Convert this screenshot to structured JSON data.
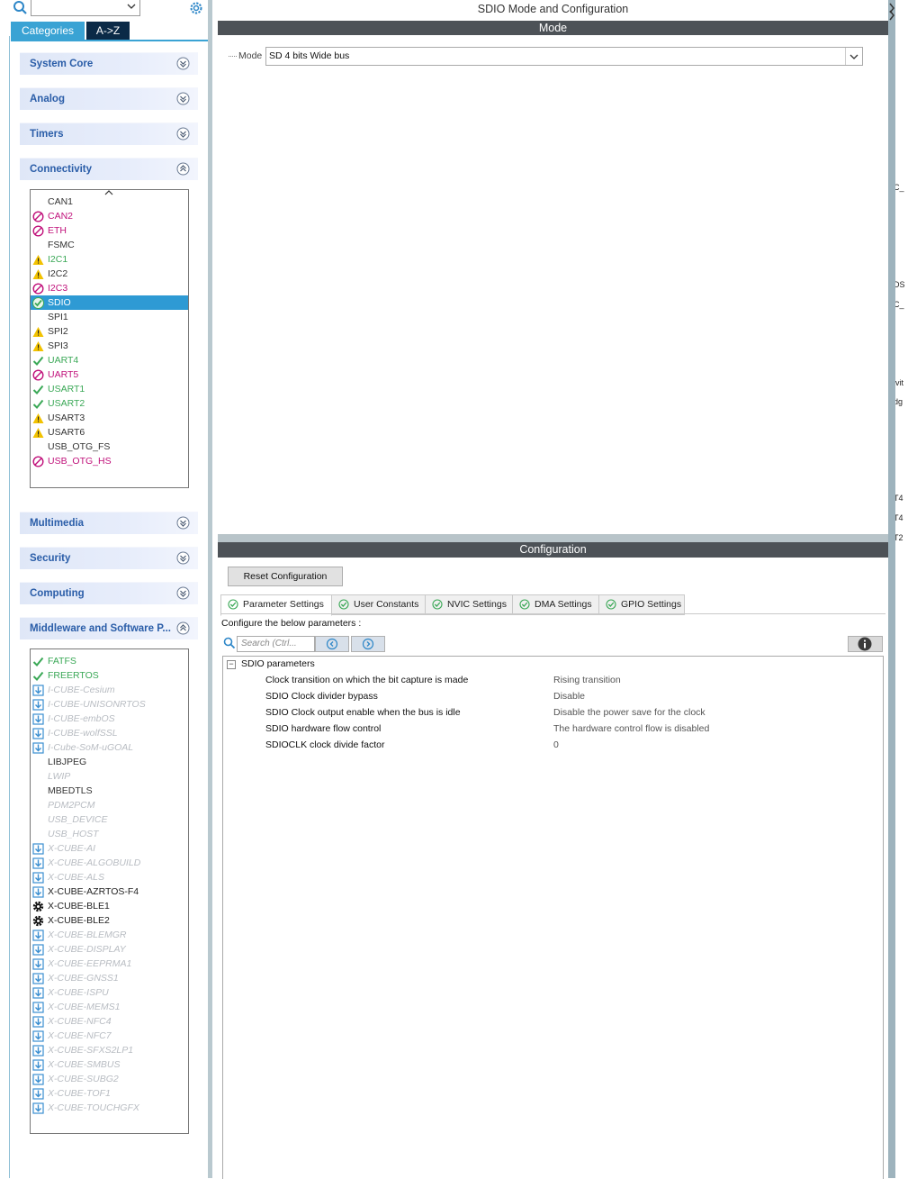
{
  "colors": {
    "accent": "#3aa3d4",
    "dark_tab": "#0b2a47",
    "category_text": "#2a5da8",
    "error": "#c0107a",
    "ok": "#3aa856",
    "warn": "#f2c200",
    "disabled": "#b8bcc2",
    "section_bar": "#4d5257",
    "selection": "#2e9ad4"
  },
  "sidebar": {
    "tabs": {
      "categories": "Categories",
      "az": "A->Z"
    },
    "categories": {
      "system_core": "System Core",
      "analog": "Analog",
      "timers": "Timers",
      "connectivity": "Connectivity",
      "multimedia": "Multimedia",
      "security": "Security",
      "computing": "Computing",
      "middleware": "Middleware and Software P..."
    },
    "connectivity_items": [
      {
        "label": "CAN1",
        "status": "none"
      },
      {
        "label": "CAN2",
        "status": "error"
      },
      {
        "label": "ETH",
        "status": "error"
      },
      {
        "label": "FSMC",
        "status": "none"
      },
      {
        "label": "I2C1",
        "status": "warn-ok"
      },
      {
        "label": "I2C2",
        "status": "warn"
      },
      {
        "label": "I2C3",
        "status": "error"
      },
      {
        "label": "SDIO",
        "status": "selected"
      },
      {
        "label": "SPI1",
        "status": "none"
      },
      {
        "label": "SPI2",
        "status": "warn"
      },
      {
        "label": "SPI3",
        "status": "warn"
      },
      {
        "label": "UART4",
        "status": "ok"
      },
      {
        "label": "UART5",
        "status": "error"
      },
      {
        "label": "USART1",
        "status": "ok"
      },
      {
        "label": "USART2",
        "status": "ok"
      },
      {
        "label": "USART3",
        "status": "warn"
      },
      {
        "label": "USART6",
        "status": "warn"
      },
      {
        "label": "USB_OTG_FS",
        "status": "none"
      },
      {
        "label": "USB_OTG_HS",
        "status": "error"
      }
    ],
    "middleware_items": [
      {
        "label": "FATFS",
        "status": "ok"
      },
      {
        "label": "FREERTOS",
        "status": "ok"
      },
      {
        "label": "I-CUBE-Cesium",
        "status": "download"
      },
      {
        "label": "I-CUBE-UNISONRTOS",
        "status": "download"
      },
      {
        "label": "I-CUBE-embOS",
        "status": "download"
      },
      {
        "label": "I-CUBE-wolfSSL",
        "status": "download"
      },
      {
        "label": "I-Cube-SoM-uGOAL",
        "status": "download"
      },
      {
        "label": "LIBJPEG",
        "status": "none"
      },
      {
        "label": "LWIP",
        "status": "disabled"
      },
      {
        "label": "MBEDTLS",
        "status": "none"
      },
      {
        "label": "PDM2PCM",
        "status": "disabled"
      },
      {
        "label": "USB_DEVICE",
        "status": "disabled"
      },
      {
        "label": "USB_HOST",
        "status": "disabled"
      },
      {
        "label": "X-CUBE-AI",
        "status": "download"
      },
      {
        "label": "X-CUBE-ALGOBUILD",
        "status": "download"
      },
      {
        "label": "X-CUBE-ALS",
        "status": "download"
      },
      {
        "label": "X-CUBE-AZRTOS-F4",
        "status": "download-dark"
      },
      {
        "label": "X-CUBE-BLE1",
        "status": "gear"
      },
      {
        "label": "X-CUBE-BLE2",
        "status": "gear"
      },
      {
        "label": "X-CUBE-BLEMGR",
        "status": "download"
      },
      {
        "label": "X-CUBE-DISPLAY",
        "status": "download"
      },
      {
        "label": "X-CUBE-EEPRMA1",
        "status": "download"
      },
      {
        "label": "X-CUBE-GNSS1",
        "status": "download"
      },
      {
        "label": "X-CUBE-ISPU",
        "status": "download"
      },
      {
        "label": "X-CUBE-MEMS1",
        "status": "download"
      },
      {
        "label": "X-CUBE-NFC4",
        "status": "download"
      },
      {
        "label": "X-CUBE-NFC7",
        "status": "download"
      },
      {
        "label": "X-CUBE-SFXS2LP1",
        "status": "download"
      },
      {
        "label": "X-CUBE-SMBUS",
        "status": "download"
      },
      {
        "label": "X-CUBE-SUBG2",
        "status": "download"
      },
      {
        "label": "X-CUBE-TOF1",
        "status": "download"
      },
      {
        "label": "X-CUBE-TOUCHGFX",
        "status": "download"
      }
    ]
  },
  "main": {
    "title": "SDIO Mode and Configuration",
    "mode_section": "Mode",
    "mode_label": "Mode",
    "mode_value": "SD 4 bits Wide bus",
    "config_section": "Configuration",
    "reset_button": "Reset Configuration",
    "tabs": [
      "Parameter Settings",
      "User Constants",
      "NVIC Settings",
      "DMA Settings",
      "GPIO Settings"
    ],
    "configure_label": "Configure the below parameters :",
    "search_placeholder": "Search (Ctrl...",
    "group_label": "SDIO parameters",
    "params": [
      {
        "name": "Clock transition on which the bit capture is made",
        "value": "Rising transition"
      },
      {
        "name": "SDIO Clock divider bypass",
        "value": "Disable"
      },
      {
        "name": "SDIO Clock output enable when the bus is idle",
        "value": "Disable the power save for the clock"
      },
      {
        "name": "SDIO hardware flow control",
        "value": "The hardware control flow is disabled"
      },
      {
        "name": "SDIOCLK clock divide factor",
        "value": "0"
      }
    ]
  },
  "right_edge_fragments": [
    "C_",
    "DS",
    "C_",
    "ivit",
    "dg",
    "T4",
    "T4",
    "T2"
  ]
}
